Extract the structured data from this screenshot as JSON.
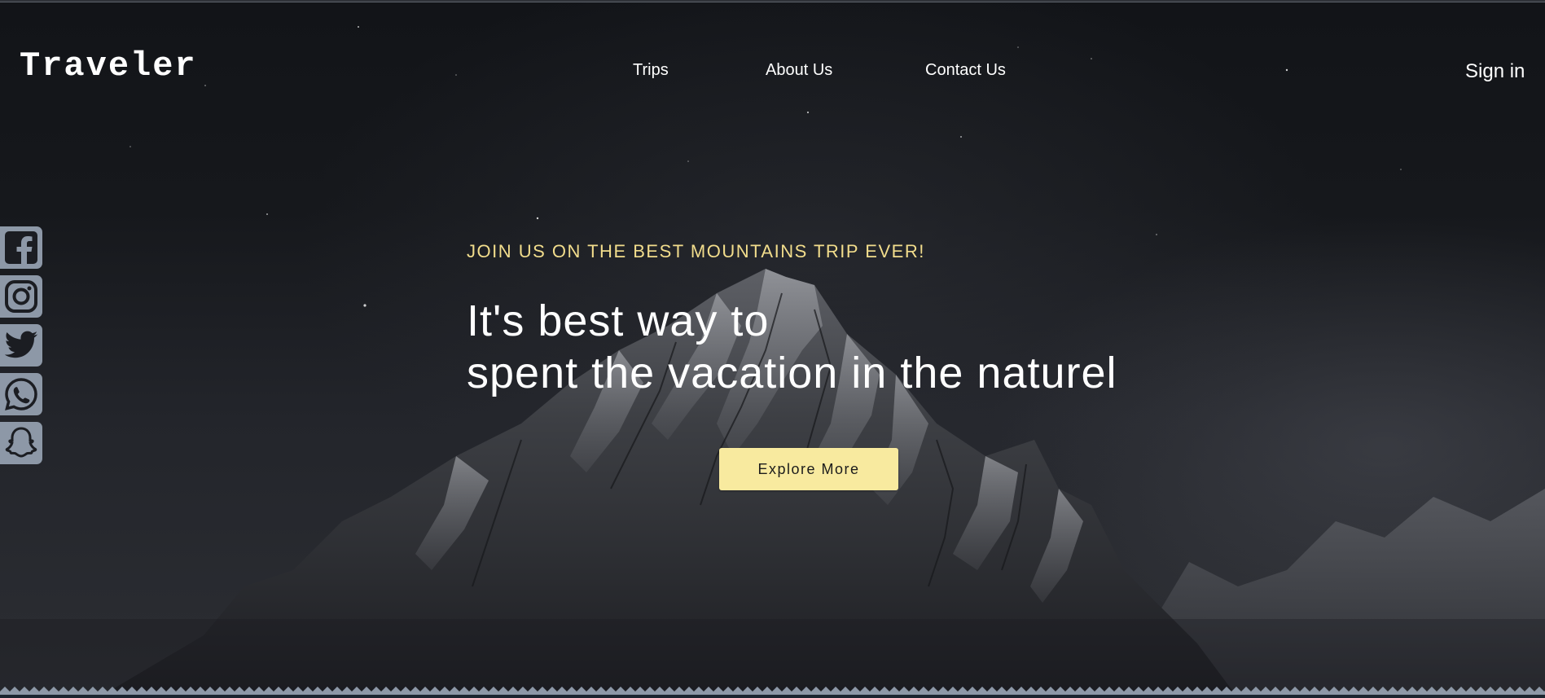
{
  "brand": {
    "name": "Traveler"
  },
  "nav": {
    "items": [
      {
        "label": "Trips"
      },
      {
        "label": "About Us"
      },
      {
        "label": "Contact Us"
      }
    ],
    "sign_in_label": "Sign in"
  },
  "social": [
    {
      "name": "facebook-icon"
    },
    {
      "name": "instagram-icon"
    },
    {
      "name": "twitter-icon"
    },
    {
      "name": "whatsapp-icon"
    },
    {
      "name": "snapchat-icon"
    }
  ],
  "hero": {
    "tagline": "JOIN US ON THE BEST MOUNTAINS TRIP EVER!",
    "headline_line1": "It's best way to",
    "headline_line2": "spent the vacation in the naturel",
    "cta_label": "Explore More"
  },
  "colors": {
    "accent": "#f8ea9f",
    "tagline": "#f2dd8c",
    "social_bg": "#8d98a7",
    "background": "#131519"
  }
}
